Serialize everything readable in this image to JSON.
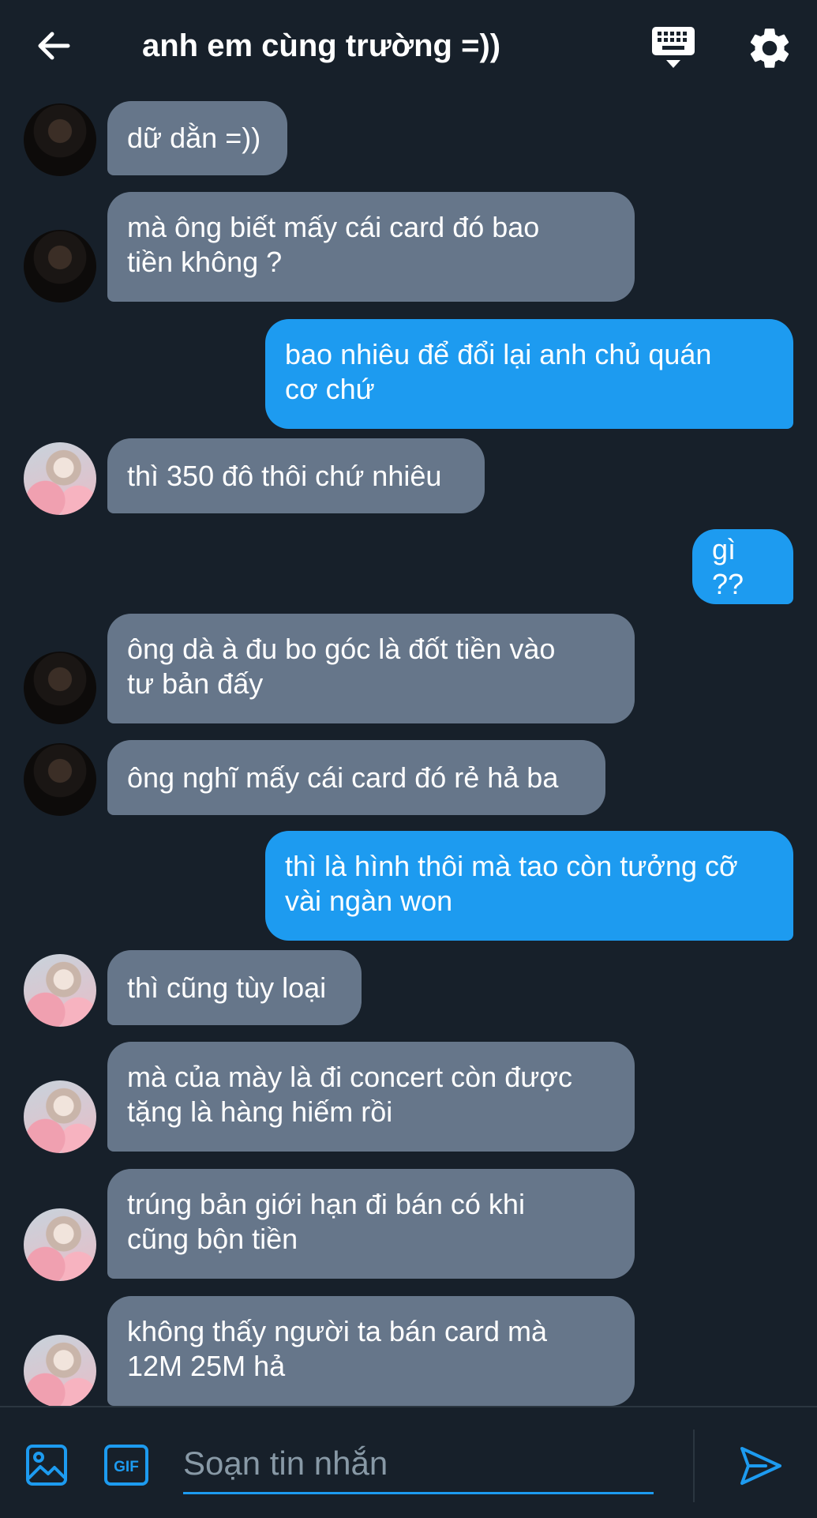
{
  "header": {
    "title": "anh em cùng trường =))",
    "back_icon": "back-arrow-icon",
    "keyboard_icon": "keyboard-icon",
    "settings_icon": "gear-icon"
  },
  "messages": [
    {
      "side": "in",
      "avatar": "a",
      "lines": [
        "dữ dằn =))"
      ]
    },
    {
      "side": "in",
      "avatar": "a",
      "lines": [
        "mà ông biết mấy cái card đó bao",
        "tiền không ?"
      ]
    },
    {
      "side": "out",
      "lines": [
        "bao nhiêu để đổi lại anh chủ quán",
        "cơ chứ"
      ]
    },
    {
      "side": "in",
      "avatar": "b",
      "lines": [
        "thì 350 đô thôi chứ nhiêu"
      ]
    },
    {
      "side": "out",
      "lines": [
        "gì ??"
      ]
    },
    {
      "side": "in",
      "avatar": "a",
      "lines": [
        "ông dà à đu bo góc là đốt tiền vào",
        "tư bản đấy"
      ]
    },
    {
      "side": "in",
      "avatar": "a",
      "lines": [
        "ông nghĩ mấy cái card đó rẻ hả ba"
      ]
    },
    {
      "side": "out",
      "lines": [
        "thì là hình thôi mà tao còn tưởng cỡ",
        "vài ngàn won"
      ]
    },
    {
      "side": "in",
      "avatar": "b",
      "lines": [
        "thì cũng tùy loại"
      ]
    },
    {
      "side": "in",
      "avatar": "b",
      "lines": [
        "mà của mày là đi concert còn được",
        "tặng là hàng hiếm rồi"
      ]
    },
    {
      "side": "in",
      "avatar": "b",
      "lines": [
        "trúng bản giới hạn đi bán có khi",
        "cũng bộn tiền"
      ]
    },
    {
      "side": "in",
      "avatar": "b",
      "lines": [
        "không thấy người ta bán card mà",
        "12M 25M hả"
      ]
    }
  ],
  "composer": {
    "placeholder": "Soạn tin nhắn",
    "media_icon": "image-icon",
    "gif_label": "GIF",
    "send_icon": "send-icon"
  },
  "colors": {
    "background": "#17202a",
    "incoming_bubble": "#66768a",
    "outgoing_bubble": "#1d9bf0",
    "accent": "#1d9bf0"
  }
}
